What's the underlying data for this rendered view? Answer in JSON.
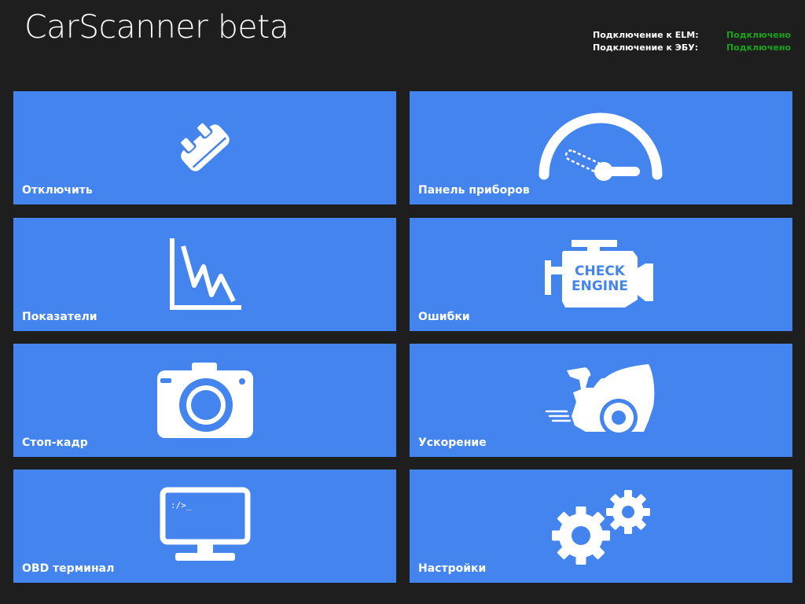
{
  "app": {
    "title": "CarScanner beta"
  },
  "status": {
    "elm_label": "Подключение к ELM:",
    "elm_value": "Подключено",
    "ecu_label": "Подключение к ЭБУ:",
    "ecu_value": "Подключено",
    "value_color": "#1aa51a"
  },
  "tiles": [
    {
      "label": "Отключить",
      "icon": "unplug-connector-icon"
    },
    {
      "label": "Панель приборов",
      "icon": "gauge-icon"
    },
    {
      "label": "Показатели",
      "icon": "chart-icon"
    },
    {
      "label": "Ошибки",
      "icon": "check-engine-icon"
    },
    {
      "label": "Стоп-кадр",
      "icon": "camera-icon"
    },
    {
      "label": "Ускорение",
      "icon": "acceleration-car-icon"
    },
    {
      "label": "OBD терминал",
      "icon": "terminal-icon",
      "icon_text": ":/>_"
    },
    {
      "label": "Настройки",
      "icon": "gears-icon"
    }
  ],
  "colors": {
    "background": "#1e1e1e",
    "tile": "#4384ee",
    "text": "#ffffff"
  }
}
